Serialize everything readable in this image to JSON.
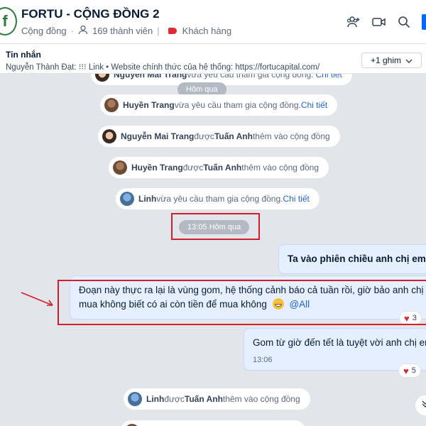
{
  "header": {
    "logo_letter": "f",
    "title": "FORTU - CỘNG ĐỒNG 2",
    "community_label": "Cộng đồng",
    "members": "169 thành viên",
    "tag_label": "Khách hàng"
  },
  "pinned": {
    "title": "Tin nhắn",
    "text": "Nguyễn Thành Đạt: ⁝⁝⁝ Link • Website chính thức của hệ thống: https://fortucapital.com/",
    "more_button": "+1 ghim"
  },
  "messages": {
    "sys0": {
      "name": "Nguyễn Mai Trang",
      "text": " vừa yêu cầu tham gia cộng đồng.",
      "link": "Chi tiết"
    },
    "date_pill": "Hôm qua",
    "sys1": {
      "name": "Huyền Trang",
      "text": " vừa yêu cầu tham gia cộng đồng. ",
      "link": "Chi tiết"
    },
    "sys2": {
      "name": "Nguyễn Mai Trang",
      "mid": " được ",
      "by": "Tuấn Anh",
      "end": " thêm vào cộng đồng"
    },
    "sys3": {
      "name": "Huyền Trang",
      "mid": " được ",
      "by": "Tuấn Anh",
      "end": " thêm vào cộng đồng"
    },
    "sys4": {
      "name": "Linh",
      "text": " vừa yêu cầu tham gia cộng đồng. ",
      "link": "Chi tiết"
    },
    "time_pill": "13:05 Hôm qua",
    "msg1": "Ta vào phiên chiều anh chị em nh",
    "msg2_line1": "Đoạn này thực ra lại là vùng gom, hệ thống cảnh báo cả tuần rồi, giờ bảo anh chị em",
    "msg2_line2": "mua không biết có ai còn tiền để mua không",
    "msg2_mention": "@All",
    "msg2_react": "3",
    "msg3_text": "Gom từ giờ đến tết là tuyệt vời anh chị em",
    "msg3_time": "13:06",
    "msg3_react": "5",
    "sys5": {
      "name": "Linh",
      "mid": " được ",
      "by": "Tuấn Anh",
      "end": " thêm vào cộng đồng"
    }
  },
  "colors": {
    "accent": "#0068ff",
    "highlight": "#d0202b",
    "bubble_blue": "#e5efff"
  }
}
